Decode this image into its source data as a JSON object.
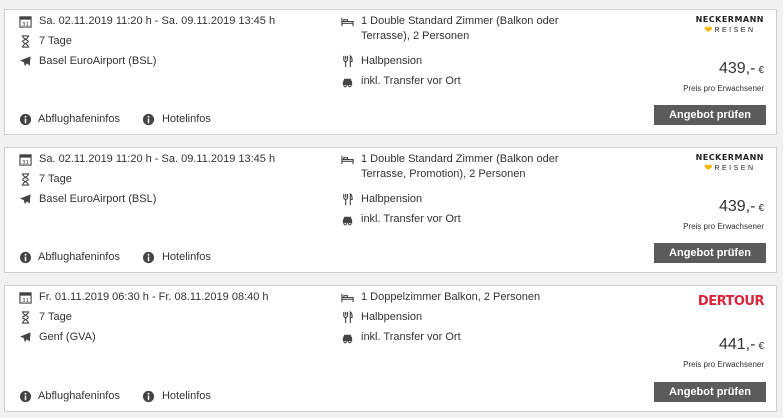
{
  "offers": [
    {
      "date": "Sa. 02.11.2019 11:20 h - Sa. 09.11.2019 13:45 h",
      "duration": "7 Tage",
      "airport": "Basel EuroAirport (BSL)",
      "room": "1 Double Standard Zimmer (Balkon oder Terrasse), 2 Personen",
      "board": "Halbpension",
      "transfer": "inkl. Transfer vor Ort",
      "brand": {
        "line1": "NECKERMANN",
        "line2": "REISEN"
      },
      "price": "439,-",
      "currency": "€",
      "per": "Preis pro Erwachsener",
      "cta": "Angebot prüfen",
      "link1": "Abflughafeninfos",
      "link2": "Hotelinfos"
    },
    {
      "date": "Sa. 02.11.2019 11:20 h - Sa. 09.11.2019 13:45 h",
      "duration": "7 Tage",
      "airport": "Basel EuroAirport (BSL)",
      "room": "1 Double Standard Zimmer (Balkon oder Terrasse, Promotion), 2 Personen",
      "board": "Halbpension",
      "transfer": "inkl. Transfer vor Ort",
      "brand": {
        "line1": "NECKERMANN",
        "line2": "REISEN"
      },
      "price": "439,-",
      "currency": "€",
      "per": "Preis pro Erwachsener",
      "cta": "Angebot prüfen",
      "link1": "Abflughafeninfos",
      "link2": "Hotelinfos"
    },
    {
      "date": "Fr. 01.11.2019 06:30 h - Fr. 08.11.2019 08:40 h",
      "duration": "7 Tage",
      "airport": "Genf (GVA)",
      "room": "1 Doppelzimmer Balkon, 2 Personen",
      "board": "Halbpension",
      "transfer": "inkl. Transfer vor Ort",
      "brand": {
        "logo": "DERTOUR"
      },
      "price": "441,-",
      "currency": "€",
      "per": "Preis pro Erwachsener",
      "cta": "Angebot prüfen",
      "link1": "Abflughafeninfos",
      "link2": "Hotelinfos"
    }
  ],
  "icons": {
    "date": "calendar-icon",
    "duration": "hourglass-icon",
    "airport": "plane-icon",
    "room": "bed-icon",
    "board": "cutlery-icon",
    "transfer": "car-icon",
    "info": "info-icon"
  },
  "colors": {
    "button": "#5b5b5b",
    "dertour_red": "#d9263a",
    "neckermann_heart": "#f5b400"
  }
}
